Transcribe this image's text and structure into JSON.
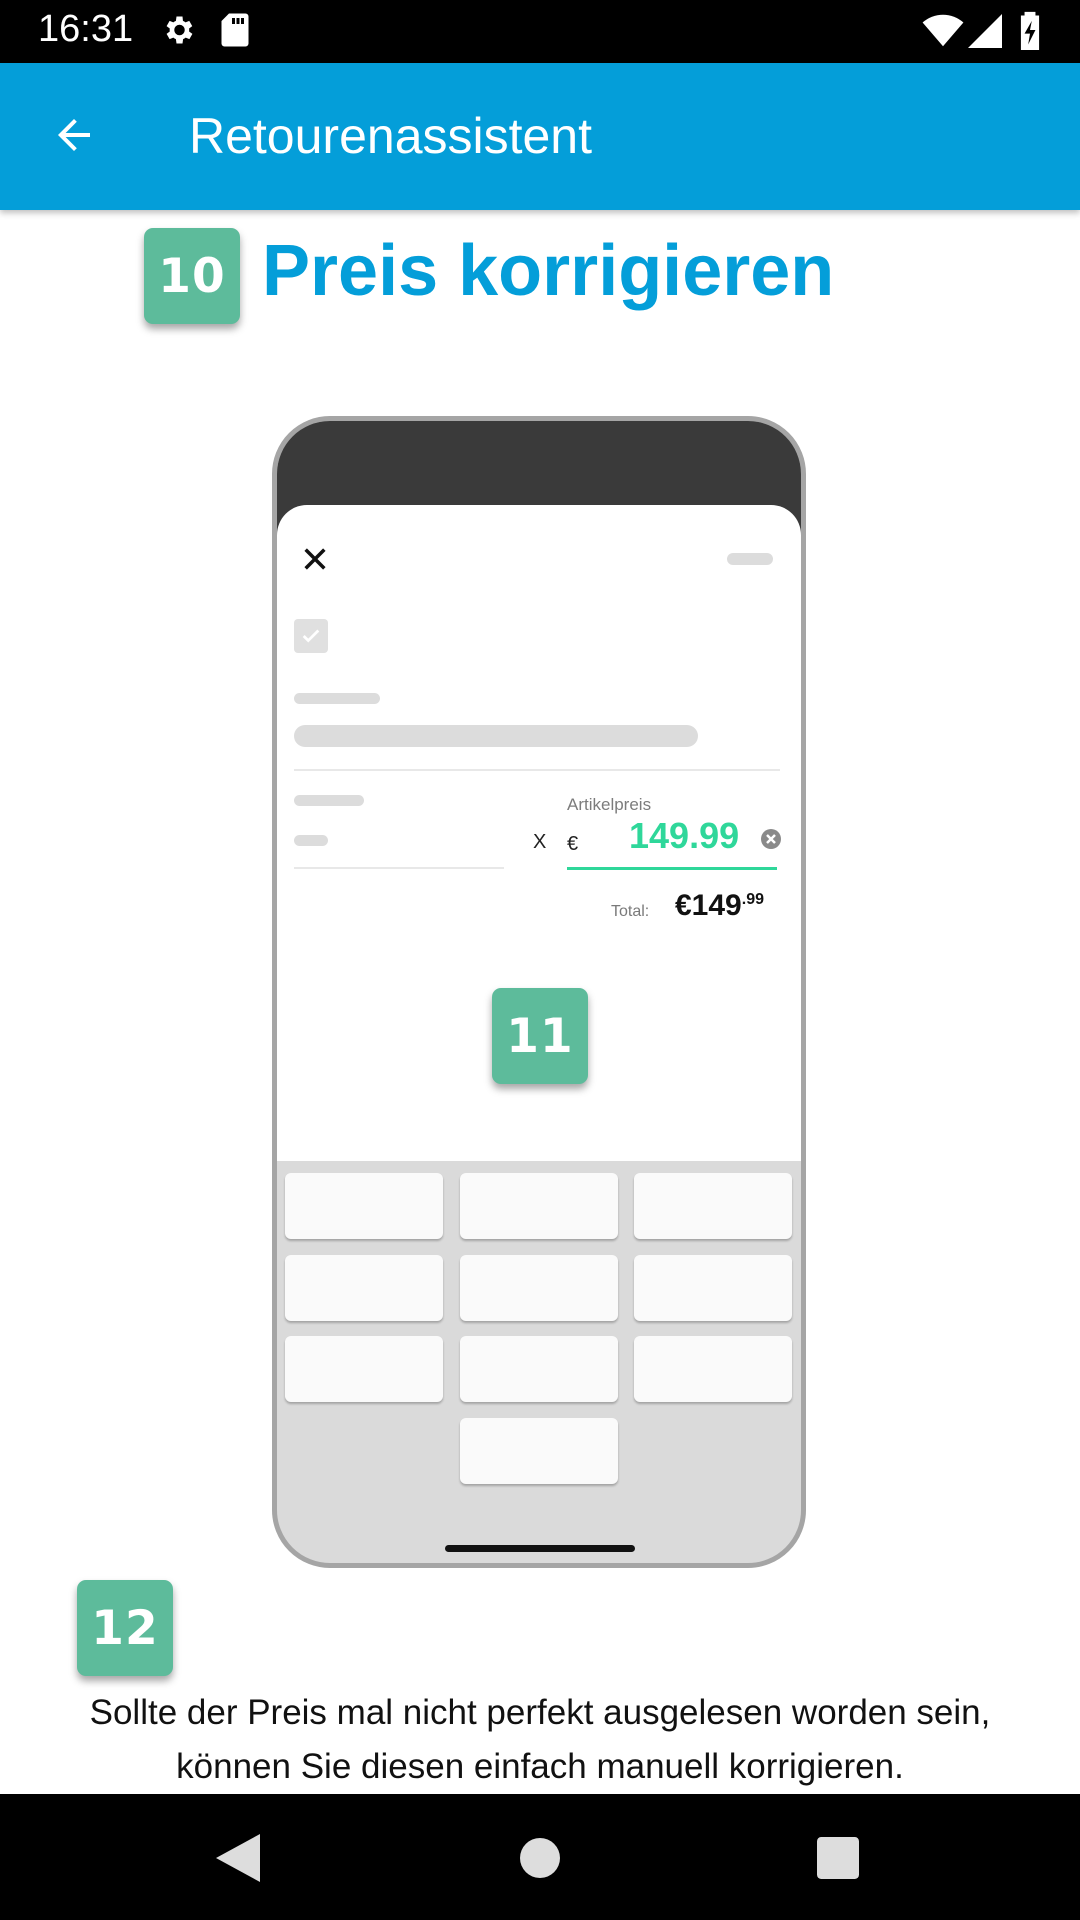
{
  "status_bar": {
    "time": "16:31",
    "icons": [
      "gear-icon",
      "sd-card-icon",
      "wifi-icon",
      "signal-icon",
      "battery-charging-icon"
    ]
  },
  "app_bar": {
    "title": "Retourenassistent",
    "back_icon": "arrow-left-icon"
  },
  "step_badges": {
    "heading_step": "10",
    "phone_step": "11",
    "text_step": "12"
  },
  "heading": "Preis korrigieren",
  "phone_mock": {
    "price_label": "Artikelpreis",
    "times_sign": "X",
    "currency": "€",
    "price_value": "149.99",
    "total_label": "Total:",
    "total_main": "€149",
    "total_cents": ".99",
    "keypad_keys": 10
  },
  "description": "Sollte der Preis mal nicht perfekt ausgelesen worden sein, können Sie diesen einfach manuell korrigieren.",
  "colors": {
    "app_bar": "#049ed9",
    "badge": "#5dbb9b",
    "price_accent": "#2fd79a"
  },
  "nav_bar": {
    "buttons": [
      "back-triangle-icon",
      "home-circle-icon",
      "recents-square-icon"
    ]
  }
}
